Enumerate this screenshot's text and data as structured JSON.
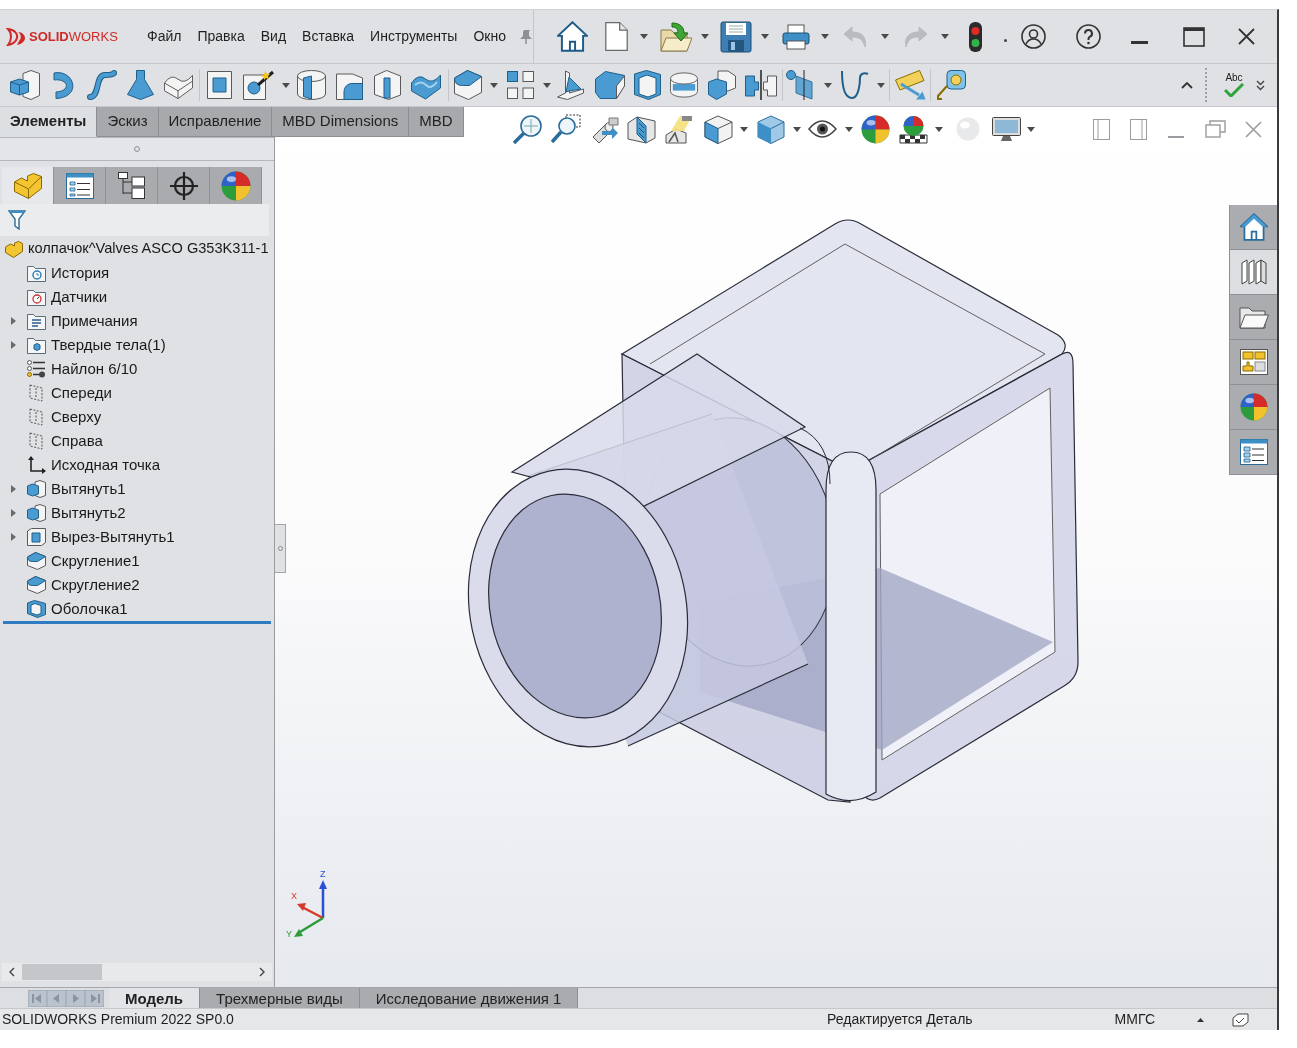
{
  "app": {
    "logo": "**SOLID**WORKS"
  },
  "menu": [
    "Файл",
    "Правка",
    "Вид",
    "Вставка",
    "Инструменты",
    "Окно"
  ],
  "quick_access": {
    "undo": {
      "disabled": true
    },
    "redo": {
      "disabled": true
    }
  },
  "command_manager": {
    "spellcheck_label": "Abc"
  },
  "command_tabs": [
    {
      "label": "Элементы",
      "selected": true
    },
    {
      "label": "Эскиз",
      "selected": false
    },
    {
      "label": "Исправление",
      "selected": false
    },
    {
      "label": "MBD Dimensions",
      "selected": false
    },
    {
      "label": "MBD",
      "selected": false
    }
  ],
  "panel_tabs": [
    {
      "selected": true
    },
    {
      "selected": false
    },
    {
      "selected": false
    },
    {
      "selected": false
    },
    {
      "selected": false
    }
  ],
  "feature_tree": {
    "label": "колпачок^Valves ASCO G353K311-1",
    "children": [
      {
        "kind": "history",
        "label": "История",
        "expandable": false
      },
      {
        "kind": "sensors",
        "label": "Датчики",
        "expandable": false
      },
      {
        "kind": "annotations",
        "label": "Примечания",
        "expandable": true
      },
      {
        "kind": "bodies",
        "label": "Твердые тела(1)",
        "expandable": true
      },
      {
        "kind": "material",
        "label": "Найлон 6/10",
        "expandable": false
      },
      {
        "kind": "plane",
        "label": "Спереди",
        "expandable": false
      },
      {
        "kind": "plane",
        "label": "Сверху",
        "expandable": false
      },
      {
        "kind": "plane",
        "label": "Справа",
        "expandable": false
      },
      {
        "kind": "origin",
        "label": "Исходная точка",
        "expandable": false
      },
      {
        "kind": "extrude",
        "label": "Вытянуть1",
        "expandable": true
      },
      {
        "kind": "extrude",
        "label": "Вытянуть2",
        "expandable": true
      },
      {
        "kind": "cut",
        "label": "Вырез-Вытянуть1",
        "expandable": true
      },
      {
        "kind": "fillet",
        "label": "Скругление1",
        "expandable": false
      },
      {
        "kind": "fillet",
        "label": "Скругление2",
        "expandable": false
      },
      {
        "kind": "shell",
        "label": "Оболочка1",
        "expandable": false
      }
    ]
  },
  "viewport": {
    "triad": [
      "Z",
      "X",
      "Y"
    ]
  },
  "task_pane": [
    {
      "selected": false
    },
    {
      "selected": true
    },
    {
      "selected": false
    },
    {
      "selected": false
    },
    {
      "selected": false
    },
    {
      "selected": false
    }
  ],
  "sheet_tabs": [
    {
      "label": "Модель",
      "selected": true
    },
    {
      "label": "Трехмерные виды",
      "selected": false
    },
    {
      "label": "Исследование движения 1",
      "selected": false
    }
  ],
  "status_bar": {
    "product": "SOLIDWORKS Premium 2022 SP0.0",
    "mode": "Редактируется Деталь",
    "units": "ММГС"
  }
}
